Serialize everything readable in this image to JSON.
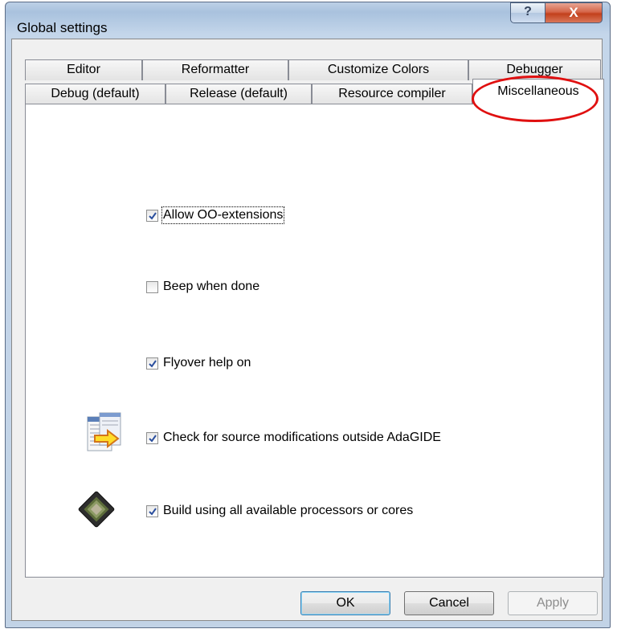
{
  "window": {
    "title": "Global settings",
    "help_label": "?",
    "close_label": "X"
  },
  "tabs_back": [
    "Editor",
    "Reformatter",
    "Customize Colors",
    "Debugger"
  ],
  "tabs_front": [
    "Debug (default)",
    "Release (default)",
    "Resource compiler",
    "Miscellaneous"
  ],
  "active_tab": "Miscellaneous",
  "options": [
    {
      "label": "Allow OO-extensions",
      "checked": true
    },
    {
      "label": "Beep when done",
      "checked": false
    },
    {
      "label": "Flyover help on",
      "checked": true
    },
    {
      "label": "Check for source modifications outside AdaGIDE",
      "checked": true,
      "icon": "file-compare-arrow-icon"
    },
    {
      "label": "Build using all available processors or cores",
      "checked": true,
      "icon": "processor-chip-icon"
    }
  ],
  "buttons": {
    "ok": "OK",
    "cancel": "Cancel",
    "apply": "Apply"
  },
  "colors": {
    "highlight_circle": "#e01010",
    "accent": "#3c7fb1"
  }
}
